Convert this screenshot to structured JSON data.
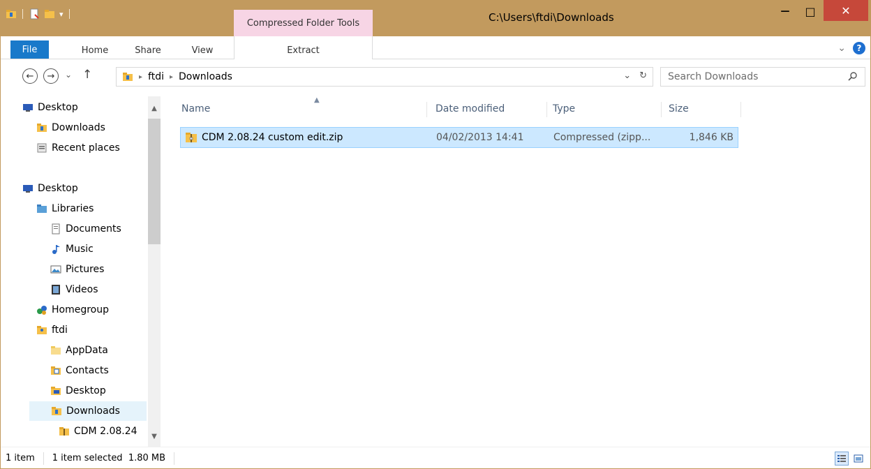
{
  "titlebar": {
    "window_title": "C:\\Users\\ftdi\\Downloads",
    "contextual_tab_group": "Compressed Folder Tools",
    "minimize_glyph": "—",
    "maximize_glyph": "□",
    "close_glyph": "✕"
  },
  "ribbon": {
    "tabs": [
      "File",
      "Home",
      "Share",
      "View",
      "Extract"
    ],
    "expand_glyph": "⌄",
    "help_glyph": "?"
  },
  "nav": {
    "back": "←",
    "forward": "→",
    "recent": "⌄",
    "up": "↑",
    "breadcrumb": [
      "ftdi",
      "Downloads"
    ],
    "breadcrumb_sep": "▸",
    "dropdown": "⌄",
    "refresh": "↻",
    "search_placeholder": "Search Downloads"
  },
  "sidebar": {
    "items": [
      {
        "label": "Desktop",
        "icon": "desktop-icon",
        "selected": false
      },
      {
        "label": "Downloads",
        "icon": "downloads-folder-icon",
        "selected": false
      },
      {
        "label": "Recent places",
        "icon": "recent-places-icon",
        "selected": false
      },
      {
        "label": "Desktop",
        "icon": "desktop-icon",
        "selected": false
      },
      {
        "label": "Libraries",
        "icon": "libraries-icon",
        "selected": false
      },
      {
        "label": "Documents",
        "icon": "documents-icon",
        "selected": false
      },
      {
        "label": "Music",
        "icon": "music-icon",
        "selected": false
      },
      {
        "label": "Pictures",
        "icon": "pictures-icon",
        "selected": false
      },
      {
        "label": "Videos",
        "icon": "videos-icon",
        "selected": false
      },
      {
        "label": "Homegroup",
        "icon": "homegroup-icon",
        "selected": false
      },
      {
        "label": "ftdi",
        "icon": "user-folder-icon",
        "selected": false
      },
      {
        "label": "AppData",
        "icon": "folder-icon",
        "selected": false
      },
      {
        "label": "Contacts",
        "icon": "contacts-folder-icon",
        "selected": false
      },
      {
        "label": "Desktop",
        "icon": "desktop-folder-icon",
        "selected": false
      },
      {
        "label": "Downloads",
        "icon": "downloads-folder-icon",
        "selected": true
      },
      {
        "label": "CDM 2.08.24",
        "icon": "zip-folder-icon",
        "selected": false
      }
    ]
  },
  "filelist": {
    "columns": [
      "Name",
      "Date modified",
      "Type",
      "Size"
    ],
    "sort_glyph": "▲",
    "rows": [
      {
        "name": "CDM 2.08.24 custom edit.zip",
        "date": "04/02/2013 14:41",
        "type": "Compressed (zipp...",
        "size": "1,846 KB"
      }
    ]
  },
  "statusbar": {
    "count": "1 item",
    "selection": "1 item selected  1.80 MB"
  },
  "colors": {
    "titlebar": "#c29a5e",
    "contextual_tab": "#f7d5e5",
    "file_tab": "#1979ca",
    "close_button": "#c6483a",
    "selection": "#cce8ff"
  }
}
